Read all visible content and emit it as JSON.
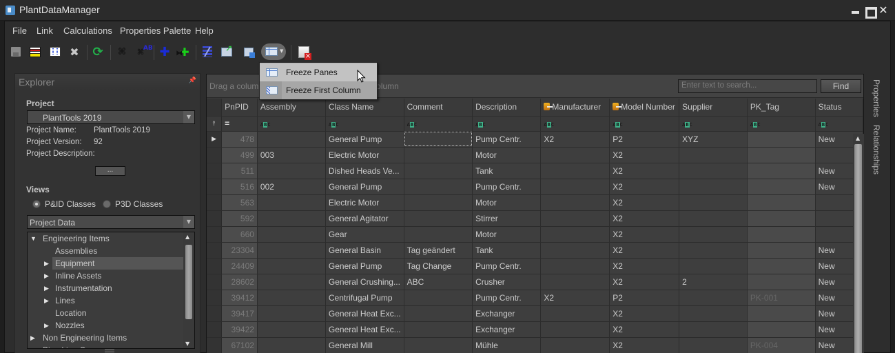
{
  "window": {
    "title": "PlantDataManager",
    "controls": [
      "minimize",
      "maximize",
      "close"
    ]
  },
  "menu": {
    "items": [
      "File",
      "Link",
      "Calculations",
      "Properties Palette",
      "Help"
    ]
  },
  "toolbar": {
    "buttons": [
      {
        "name": "save",
        "icon": "floppy-disk-icon"
      },
      {
        "name": "rows-view",
        "icon": "rows-icon"
      },
      {
        "name": "columns-view",
        "icon": "columns-icon"
      },
      {
        "name": "delete",
        "icon": "x-icon"
      },
      {
        "name": "refresh",
        "icon": "refresh-icon"
      },
      {
        "name": "find",
        "icon": "binoculars-icon"
      },
      {
        "name": "find-replace",
        "icon": "binoculars-ab-icon"
      },
      {
        "name": "add",
        "icon": "plus-icon"
      },
      {
        "name": "add-valve",
        "icon": "valve-plus-icon"
      },
      {
        "name": "link",
        "icon": "link-icon"
      },
      {
        "name": "export",
        "icon": "export-icon"
      },
      {
        "name": "select-table",
        "icon": "table-select-icon"
      },
      {
        "name": "freeze",
        "icon": "freeze-icon",
        "active": true
      },
      {
        "name": "close-document",
        "icon": "close-document-icon"
      }
    ]
  },
  "freeze_menu": {
    "items": [
      {
        "label": "Freeze Panes",
        "hovered": true
      },
      {
        "label": "Freeze First Column",
        "hovered": false
      }
    ]
  },
  "explorer": {
    "title": "Explorer",
    "project_section": "Project",
    "project_selected": "PlantTools 2019",
    "properties": [
      {
        "label": "Project Name:",
        "value": "PlantTools 2019"
      },
      {
        "label": "Project Version:",
        "value": "92"
      },
      {
        "label": "Project Description:",
        "value": ""
      }
    ],
    "more_button": "...",
    "views_section": "Views",
    "view_options": [
      {
        "label": "P&ID Classes",
        "selected": true
      },
      {
        "label": "P3D Classes",
        "selected": false
      }
    ],
    "data_source": "Project Data",
    "tree": [
      {
        "label": "Engineering Items",
        "level": 0,
        "expanded": true,
        "has_children": true
      },
      {
        "label": "Assemblies",
        "level": 1,
        "has_children": false
      },
      {
        "label": "Equipment",
        "level": 1,
        "has_children": true,
        "selected": true
      },
      {
        "label": "Inline Assets",
        "level": 1,
        "has_children": true
      },
      {
        "label": "Instrumentation",
        "level": 1,
        "has_children": true
      },
      {
        "label": "Lines",
        "level": 1,
        "has_children": true
      },
      {
        "label": "Location",
        "level": 1,
        "has_children": false
      },
      {
        "label": "Nozzles",
        "level": 1,
        "has_children": true
      },
      {
        "label": "Non Engineering Items",
        "level": 0,
        "has_children": true
      },
      {
        "label": "Pipe Line Groups",
        "level": 0,
        "has_children": false
      }
    ]
  },
  "grid": {
    "group_hint": "Drag a column header here to group by that column",
    "search_placeholder": "Enter text to search...",
    "find_label": "Find",
    "columns": [
      "PnPID",
      "Assembly",
      "Class Name",
      "Comment",
      "Description",
      "Manufacturer",
      "Model Number",
      "Supplier",
      "PK_Tag",
      "Status"
    ],
    "filter_row": [
      "=",
      "ABC",
      "ABC",
      "ABC",
      "ABC",
      "ABC",
      "ABC",
      "ABC",
      "ABC",
      "ABC"
    ],
    "rows": [
      [
        "478",
        "",
        "General Pump",
        "",
        "Pump Centr.",
        "X2",
        "P2",
        "XYZ",
        "",
        "New"
      ],
      [
        "499",
        "003",
        "Electric Motor",
        "",
        "Motor",
        "",
        "X2",
        "",
        "",
        ""
      ],
      [
        "511",
        "",
        "Dished Heads Ve...",
        "",
        "Tank",
        "",
        "X2",
        "",
        "",
        "New"
      ],
      [
        "516",
        "002",
        "General Pump",
        "",
        "Pump Centr.",
        "",
        "X2",
        "",
        "",
        "New"
      ],
      [
        "563",
        "",
        "Electric Motor",
        "",
        "Motor",
        "",
        "X2",
        "",
        "",
        ""
      ],
      [
        "592",
        "",
        "General Agitator",
        "",
        "Stirrer",
        "",
        "X2",
        "",
        "",
        ""
      ],
      [
        "660",
        "",
        "Gear",
        "",
        "Motor",
        "",
        "X2",
        "",
        "",
        ""
      ],
      [
        "23304",
        "",
        "General Basin",
        "Tag geändert",
        "Tank",
        "",
        "X2",
        "",
        "",
        "New"
      ],
      [
        "24409",
        "",
        "General Pump",
        "Tag Change",
        "Pump Centr.",
        "",
        "X2",
        "",
        "",
        "New"
      ],
      [
        "28602",
        "",
        "General Crushing...",
        "ABC",
        "Crusher",
        "",
        "X2",
        "2",
        "",
        "New"
      ],
      [
        "39412",
        "",
        "Centrifugal Pump",
        "",
        "Pump Centr.",
        "X2",
        "P2",
        "",
        "PK-001",
        "New"
      ],
      [
        "39417",
        "",
        "General Heat Exc...",
        "",
        "Exchanger",
        "",
        "X2",
        "",
        "",
        "New"
      ],
      [
        "39422",
        "",
        "General Heat Exc...",
        "",
        "Exchanger",
        "",
        "X2",
        "",
        "",
        "New"
      ],
      [
        "67102",
        "",
        "General Mill",
        "",
        "Mühle",
        "",
        "X2",
        "",
        "PK-004",
        "New"
      ]
    ],
    "current_row": 0
  },
  "side_tabs": [
    "Properties",
    "Relationships"
  ]
}
